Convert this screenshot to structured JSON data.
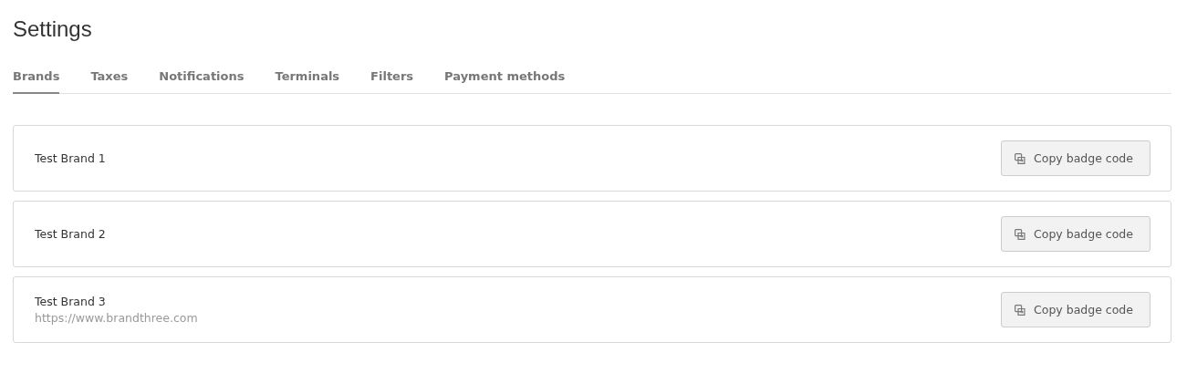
{
  "title": "Settings",
  "tabs": [
    {
      "label": "Brands",
      "selected": true
    },
    {
      "label": "Taxes",
      "selected": false
    },
    {
      "label": "Notifications",
      "selected": false
    },
    {
      "label": "Terminals",
      "selected": false
    },
    {
      "label": "Filters",
      "selected": false
    },
    {
      "label": "Payment methods",
      "selected": false
    }
  ],
  "brands": [
    {
      "name": "Test Brand 1",
      "button": "Copy badge code"
    },
    {
      "name": "Test Brand 2",
      "button": "Copy badge code"
    },
    {
      "name": "Test Brand 3",
      "url": "https://www.brandthree.com",
      "button": "Copy badge code"
    }
  ]
}
